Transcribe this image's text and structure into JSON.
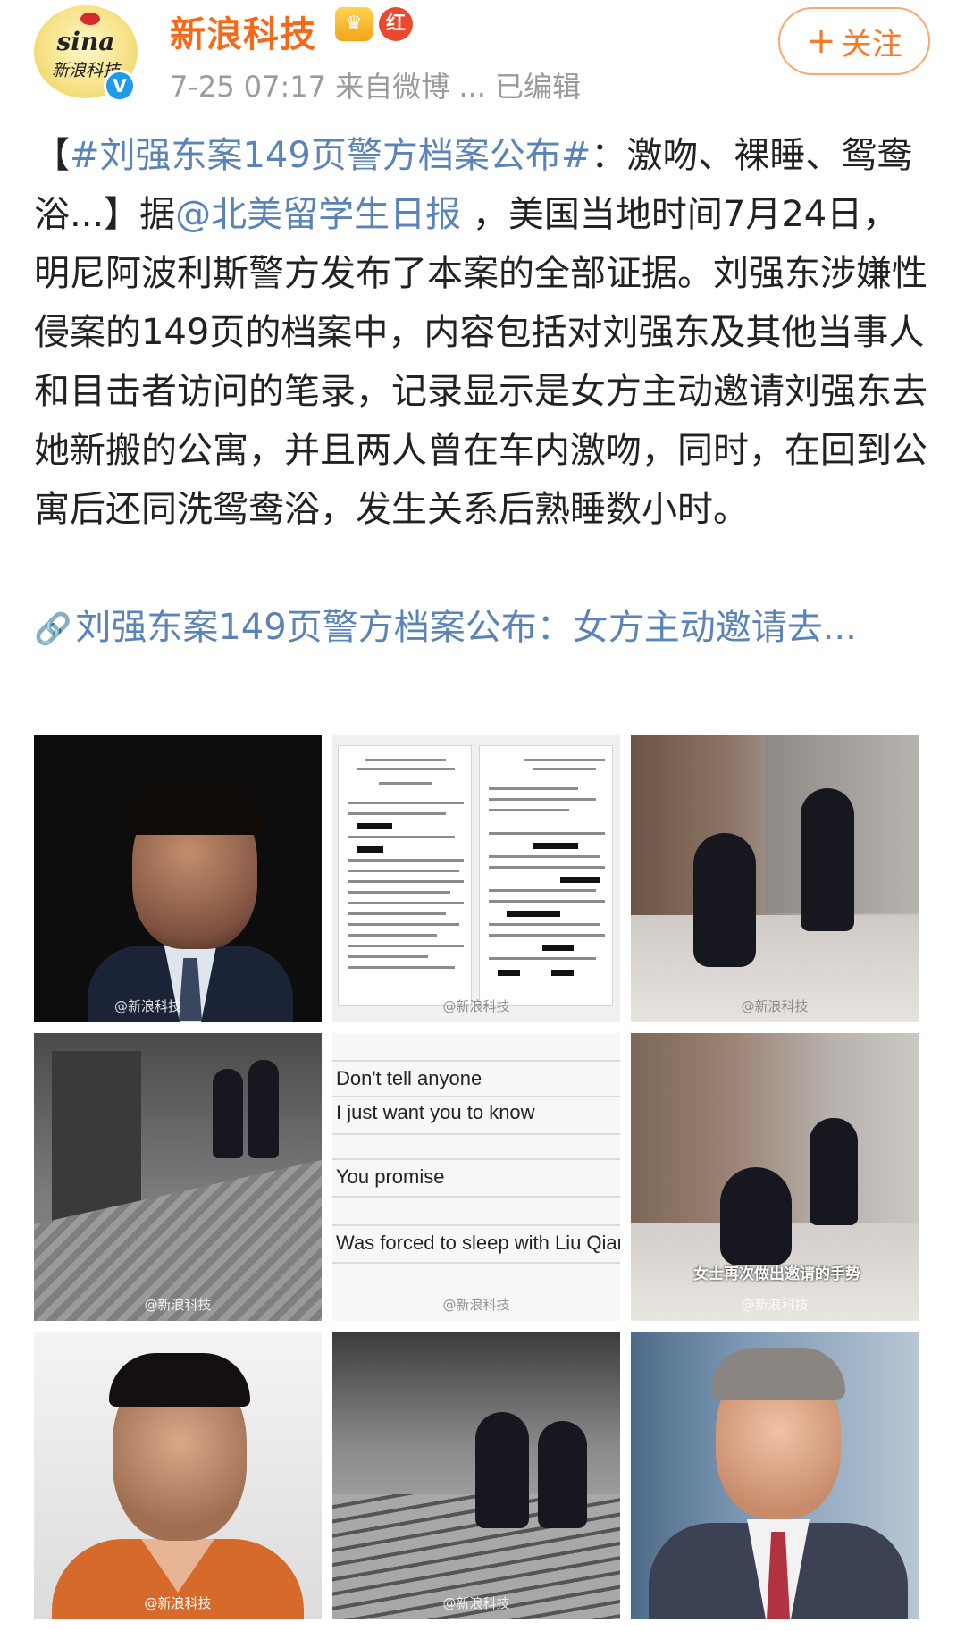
{
  "header": {
    "account_name": "新浪科技",
    "avatar_logo_top": "sina",
    "avatar_logo_bottom": "新浪科技",
    "verified_mark": "V",
    "vip_badge": "♛",
    "red_badge": "红",
    "meta": "7-25 07:17  来自微博 ...  已编辑",
    "follow_plus": "+",
    "follow_label": "关注"
  },
  "post": {
    "open_bracket": "【",
    "hashtag": "#刘强东案149页警方档案公布#",
    "headline_rest": "：激吻、裸睡、鸳鸯浴...】据",
    "mention": "@北美留学生日报",
    "body": " ，美国当地时间7月24日， 明尼阿波利斯警方发布了本案的全部证据。刘强东涉嫌性侵案的149页的档案中，内容包括对刘强东及其他当事人和目击者访问的笔录，记录显示是女方主动邀请刘强东去她新搬的公寓，并且两人曾在车内激吻，同时，在回到公寓后还同洗鸳鸯浴，发生关系后熟睡数小时。",
    "link_icon": "link-icon",
    "link_text": "刘强东案149页警方档案公布：女方主动邀请去..."
  },
  "photos": {
    "watermark": "@新浪科技",
    "p5_lines": [
      "Don't tell anyone",
      "I just want you to know",
      "You promise",
      "Was forced to sleep with Liu Qian"
    ],
    "p6_caption": "女士再次做出邀请的手势"
  },
  "colors": {
    "brand_orange": "#f26a1a",
    "link_blue": "#5a83b8",
    "meta_gray": "#9b9b9b"
  }
}
